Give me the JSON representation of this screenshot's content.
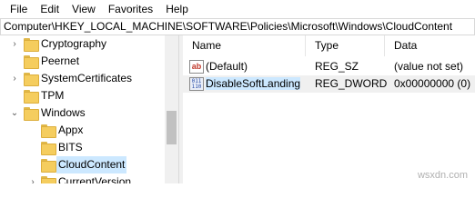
{
  "menu": [
    "File",
    "Edit",
    "View",
    "Favorites",
    "Help"
  ],
  "address": "Computer\\HKEY_LOCAL_MACHINE\\SOFTWARE\\Policies\\Microsoft\\Windows\\CloudContent",
  "tree": {
    "items": [
      {
        "label": "Cryptography",
        "expander": "›"
      },
      {
        "label": "Peernet",
        "expander": ""
      },
      {
        "label": "SystemCertificates",
        "expander": "›"
      },
      {
        "label": "TPM",
        "expander": ""
      },
      {
        "label": "Windows",
        "expander": "⌄"
      },
      {
        "label": "Appx",
        "expander": ""
      },
      {
        "label": "BITS",
        "expander": ""
      },
      {
        "label": "CloudContent",
        "expander": "",
        "selected": true
      },
      {
        "label": "CurrentVersion",
        "expander": "›"
      }
    ]
  },
  "list": {
    "columns": [
      "Name",
      "Type",
      "Data"
    ],
    "rows": [
      {
        "icon": "string-value-icon",
        "icon_text": "ab",
        "name": "(Default)",
        "type": "REG_SZ",
        "data": "(value not set)"
      },
      {
        "icon": "dword-value-icon",
        "icon_text": "011 110",
        "name": "DisableSoftLanding",
        "type": "REG_DWORD",
        "data": "0x00000000 (0)",
        "selected": true
      }
    ]
  },
  "watermark": "wsxdn.com",
  "colors": {
    "selection": "#cce8ff",
    "folder": "#f5cd5e"
  }
}
